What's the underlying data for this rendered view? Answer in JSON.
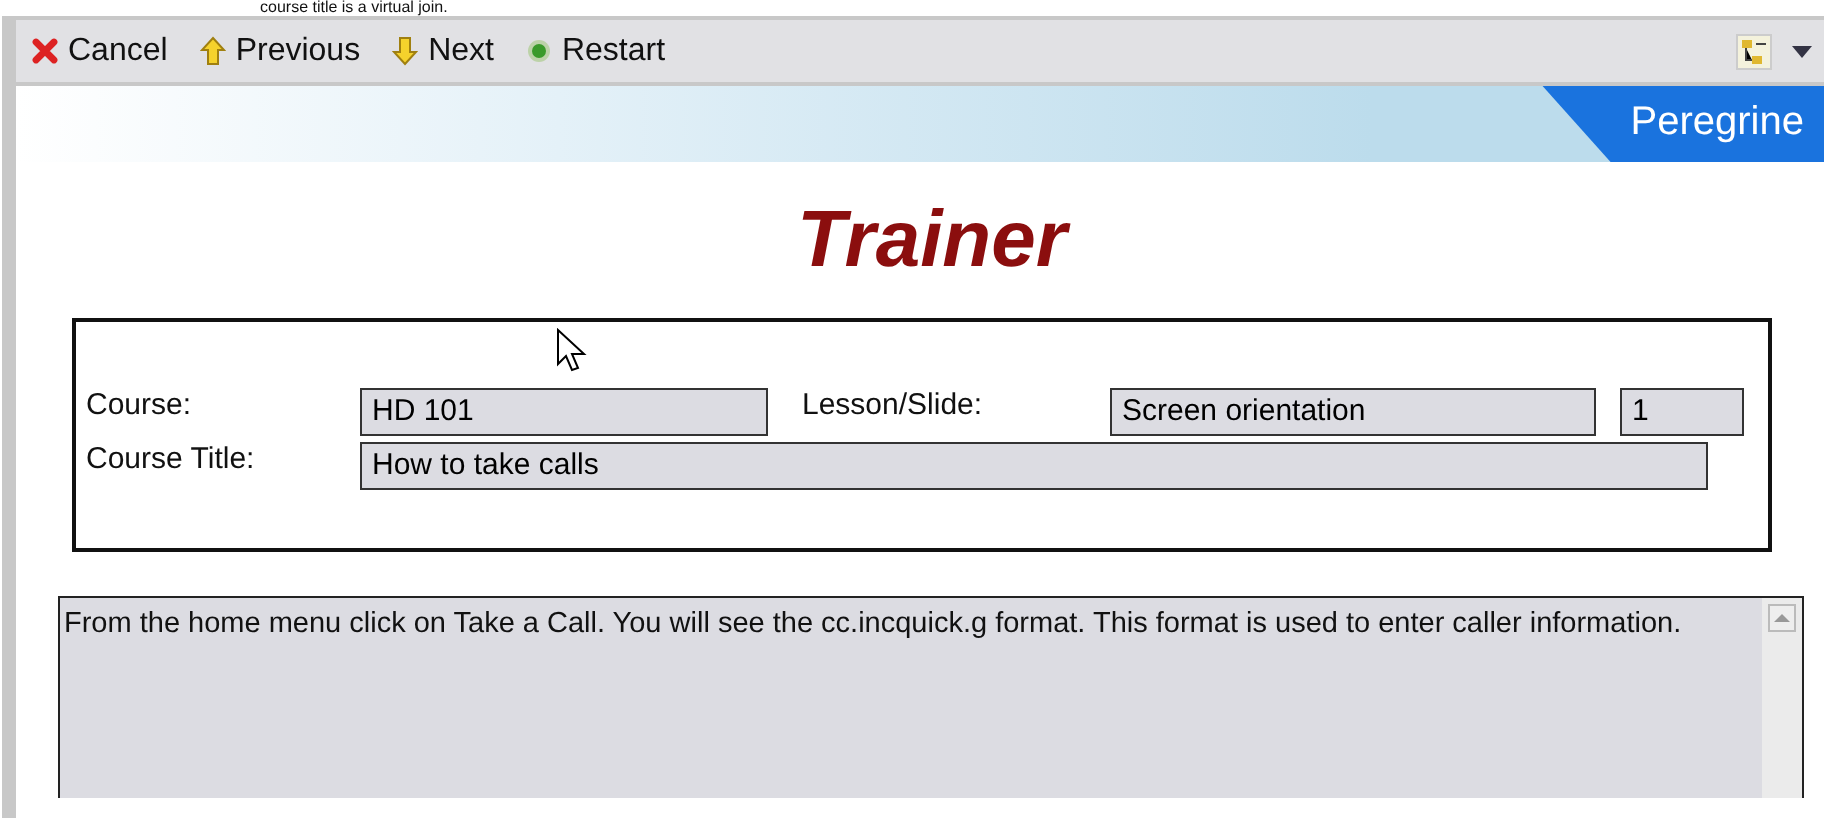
{
  "caption": "course title is a virtual join.",
  "toolbar": {
    "buttons": [
      {
        "kind": "cancel",
        "label": "Cancel"
      },
      {
        "kind": "previous",
        "label": "Previous"
      },
      {
        "kind": "next",
        "label": "Next"
      },
      {
        "kind": "restart",
        "label": "Restart"
      }
    ]
  },
  "banner": {
    "brand": "Peregrine"
  },
  "title": "Trainer",
  "form": {
    "course_label": "Course:",
    "course": "HD 101",
    "lesson_label": "Lesson/Slide:",
    "lesson": "Screen orientation",
    "slide": "1",
    "title_label": "Course Title:",
    "course_title": "How to take calls"
  },
  "description": "From the home menu click on Take a Call. You will see the cc.incquick.g format. This format is used to enter caller information."
}
